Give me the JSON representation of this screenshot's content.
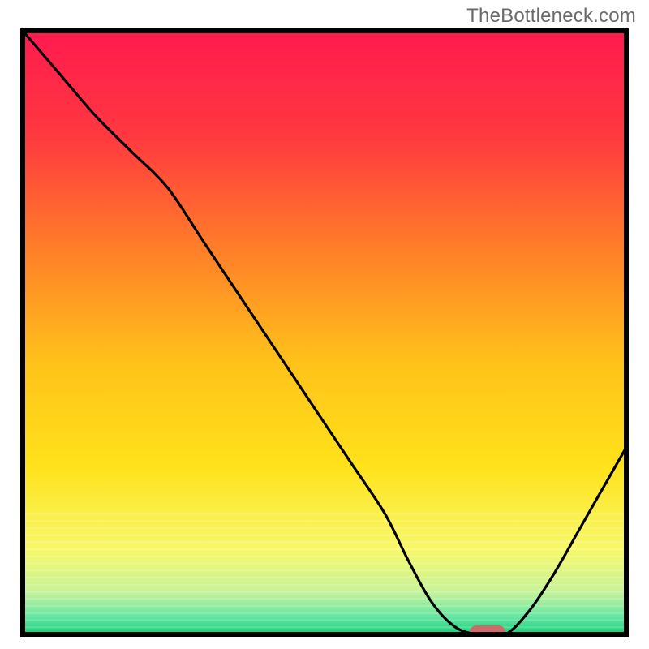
{
  "watermark": "TheBottleneck.com",
  "chart_data": {
    "type": "line",
    "title": "",
    "xlabel": "",
    "ylabel": "",
    "xlim": [
      0,
      100
    ],
    "ylim": [
      0,
      100
    ],
    "grid": false,
    "legend": false,
    "x": [
      0,
      6,
      12,
      18,
      24,
      30,
      36,
      42,
      48,
      54,
      60,
      64,
      68,
      72,
      76,
      80,
      84,
      88,
      92,
      96,
      100
    ],
    "values": [
      100,
      93,
      86,
      80,
      74,
      65,
      56,
      47,
      38,
      29,
      20,
      12,
      5,
      1,
      0,
      0,
      4,
      10,
      17,
      24,
      31
    ],
    "marker": {
      "x_center": 77,
      "y": 0,
      "width": 6,
      "color": "#d06a6a"
    },
    "background": {
      "gradient_stops": [
        {
          "pos": 0.0,
          "color": "#ff1a4f"
        },
        {
          "pos": 0.18,
          "color": "#ff3a3f"
        },
        {
          "pos": 0.35,
          "color": "#ff7a2a"
        },
        {
          "pos": 0.55,
          "color": "#ffc21a"
        },
        {
          "pos": 0.72,
          "color": "#ffe21a"
        },
        {
          "pos": 0.86,
          "color": "#f8f86a"
        },
        {
          "pos": 0.93,
          "color": "#c6f39a"
        },
        {
          "pos": 0.97,
          "color": "#67e6a3"
        },
        {
          "pos": 1.0,
          "color": "#18d07a"
        }
      ]
    }
  }
}
